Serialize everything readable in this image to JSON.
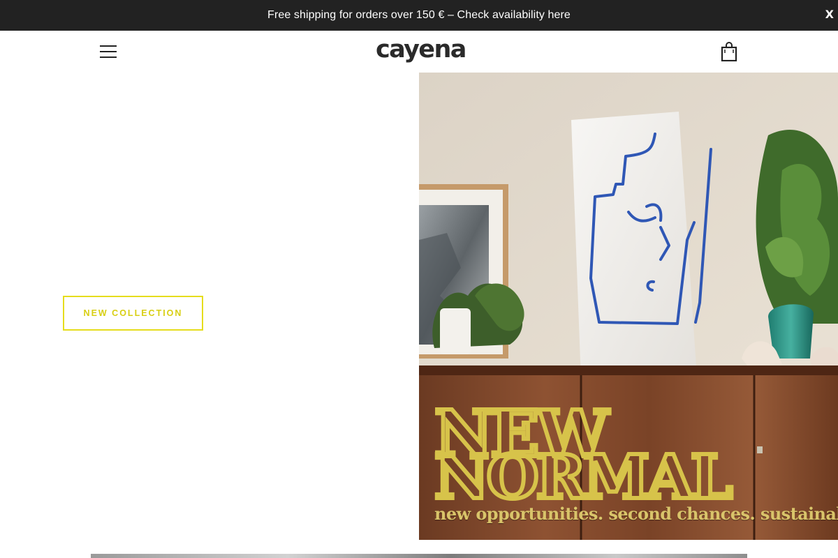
{
  "announcement": {
    "text": "Free shipping for orders over 150 € – Check availability here",
    "close_label": "X"
  },
  "header": {
    "logo_text": "cayena",
    "menu_icon": "hamburger-menu-icon",
    "cart_icon": "shopping-bag-icon"
  },
  "hero": {
    "cta_label": "NEW COLLECTION",
    "banner": {
      "title_line1": "NEW",
      "title_line2": "NORMAL",
      "tagline": "new opportunities. second chances. sustainable mind"
    }
  },
  "colors": {
    "announcement_bg": "#222222",
    "accent_yellow": "#e6dd1c",
    "banner_gold": "#d9c46a"
  }
}
